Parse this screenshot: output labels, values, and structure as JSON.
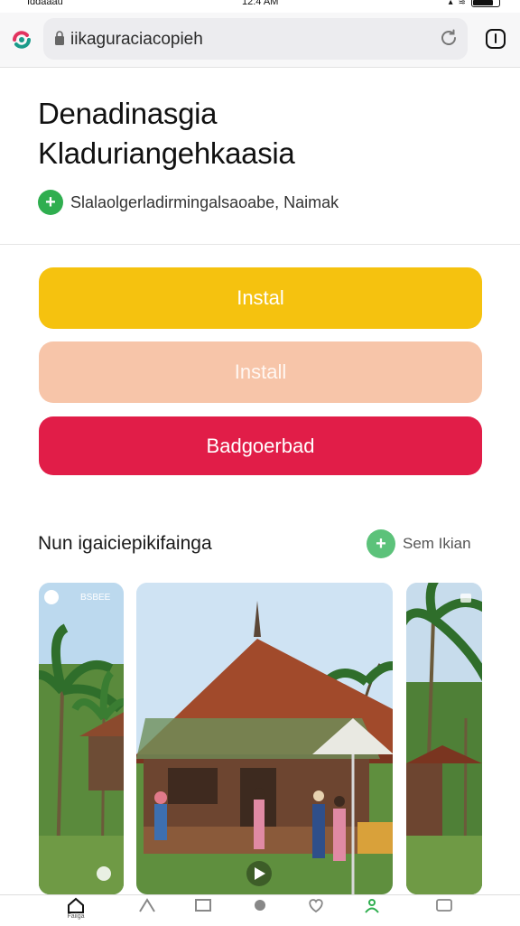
{
  "status": {
    "left": "Iddaaau",
    "time": "12:4 AM"
  },
  "browser": {
    "url": "iikaguraciacopieh"
  },
  "header": {
    "title_line1": "Denadinasgia",
    "title_line2": "Kladuriangehkaasia",
    "subtitle": "Slalaolgerladirmingalsaoabe, Naimak"
  },
  "buttons": {
    "primary": "Instal",
    "secondary": "Install",
    "tertiary": "Badgoerbad"
  },
  "section": {
    "title": "Nun igaiciepikifainga",
    "see_all": "Sem Ikian"
  },
  "cards": {
    "left_badge": "BSBEE"
  },
  "nav": {
    "items": [
      {
        "label": "Faiiga",
        "icon": "home-icon"
      },
      {
        "label": "",
        "icon": "explore-icon"
      },
      {
        "label": "",
        "icon": "media-icon"
      },
      {
        "label": "",
        "icon": "notification-icon"
      },
      {
        "label": "",
        "icon": "heart-icon"
      },
      {
        "label": "",
        "icon": "people-icon"
      },
      {
        "label": "",
        "icon": "settings-icon"
      }
    ]
  },
  "colors": {
    "yellow": "#f5c20f",
    "peach": "#f7c5a9",
    "red": "#e11d48",
    "green": "#2fae4f"
  }
}
